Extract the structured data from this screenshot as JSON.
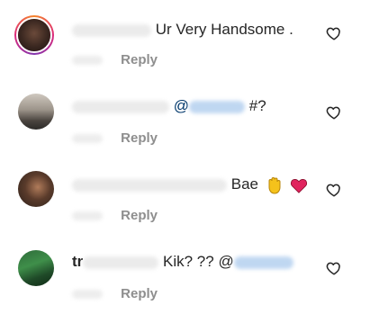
{
  "comments": [
    {
      "text": "Ur Very Handsome .",
      "reply_label": "Reply",
      "like_icon": "heart-outline-icon"
    },
    {
      "text_before": "@",
      "text_after": "#?",
      "reply_label": "Reply",
      "like_icon": "heart-outline-icon"
    },
    {
      "text": "Bae",
      "emojis": [
        "raised-hand-emoji",
        "heart-emoji"
      ],
      "reply_label": "Reply",
      "like_icon": "heart-outline-icon"
    },
    {
      "username_visible": "tr",
      "text": "Kik? ?? @",
      "reply_label": "Reply",
      "like_icon": "heart-outline-icon"
    }
  ]
}
